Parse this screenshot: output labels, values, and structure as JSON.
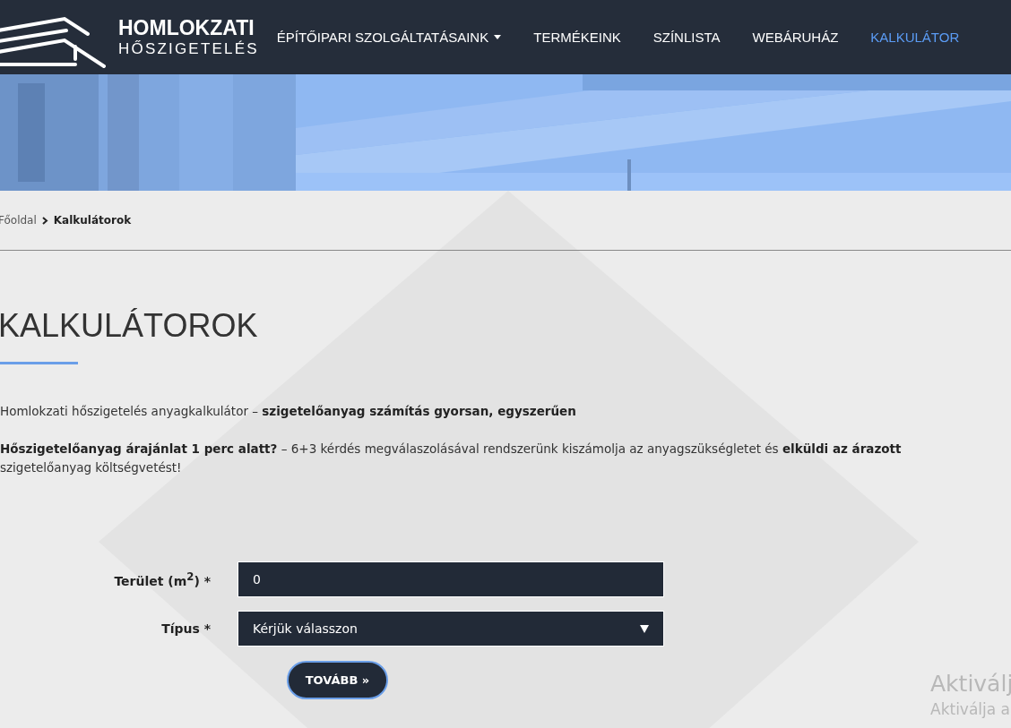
{
  "header": {
    "logo": {
      "title": "HOMLOKZATI",
      "subtitle": "HŐSZIGETELÉS"
    },
    "nav": [
      {
        "label": "ÉPÍTŐIPARI SZOLGÁLTATÁSAINK",
        "dropdown": true,
        "selected": false
      },
      {
        "label": "TERMÉKEINK",
        "dropdown": false,
        "selected": false
      },
      {
        "label": "SZÍNLISTA",
        "dropdown": false,
        "selected": false
      },
      {
        "label": "WEBÁRUHÁZ",
        "dropdown": false,
        "selected": false
      },
      {
        "label": "KALKULÁTOR",
        "dropdown": false,
        "selected": true
      }
    ]
  },
  "breadcrumb": {
    "home": "Főoldal",
    "current": "Kalkulátorok"
  },
  "title": "KALKULÁTOROK",
  "paragraphs": [
    "Homlokzati hőszigetelés anyagkalkulátor – **szigetelőanyag számítás gyorsan, egyszerűen**",
    "**Hőszigetelőanyag árajánlat 1 perc alatt?** – 6+3 kérdés megválaszolásával rendszerünk kiszámolja az anyagszükségletet és **elküldi az árazott** szigetelőanyag költségvetést!"
  ],
  "form": {
    "fields": [
      {
        "kind": "input",
        "label": "Terület (m$^{2}$) *",
        "value": "0"
      },
      {
        "kind": "select",
        "label": "Típus *",
        "value": "Kérjük válasszon"
      }
    ],
    "submit": "TOVÁBB »"
  },
  "os_notice": {
    "title": "Aktiválj",
    "text": "Aktiválja a"
  }
}
